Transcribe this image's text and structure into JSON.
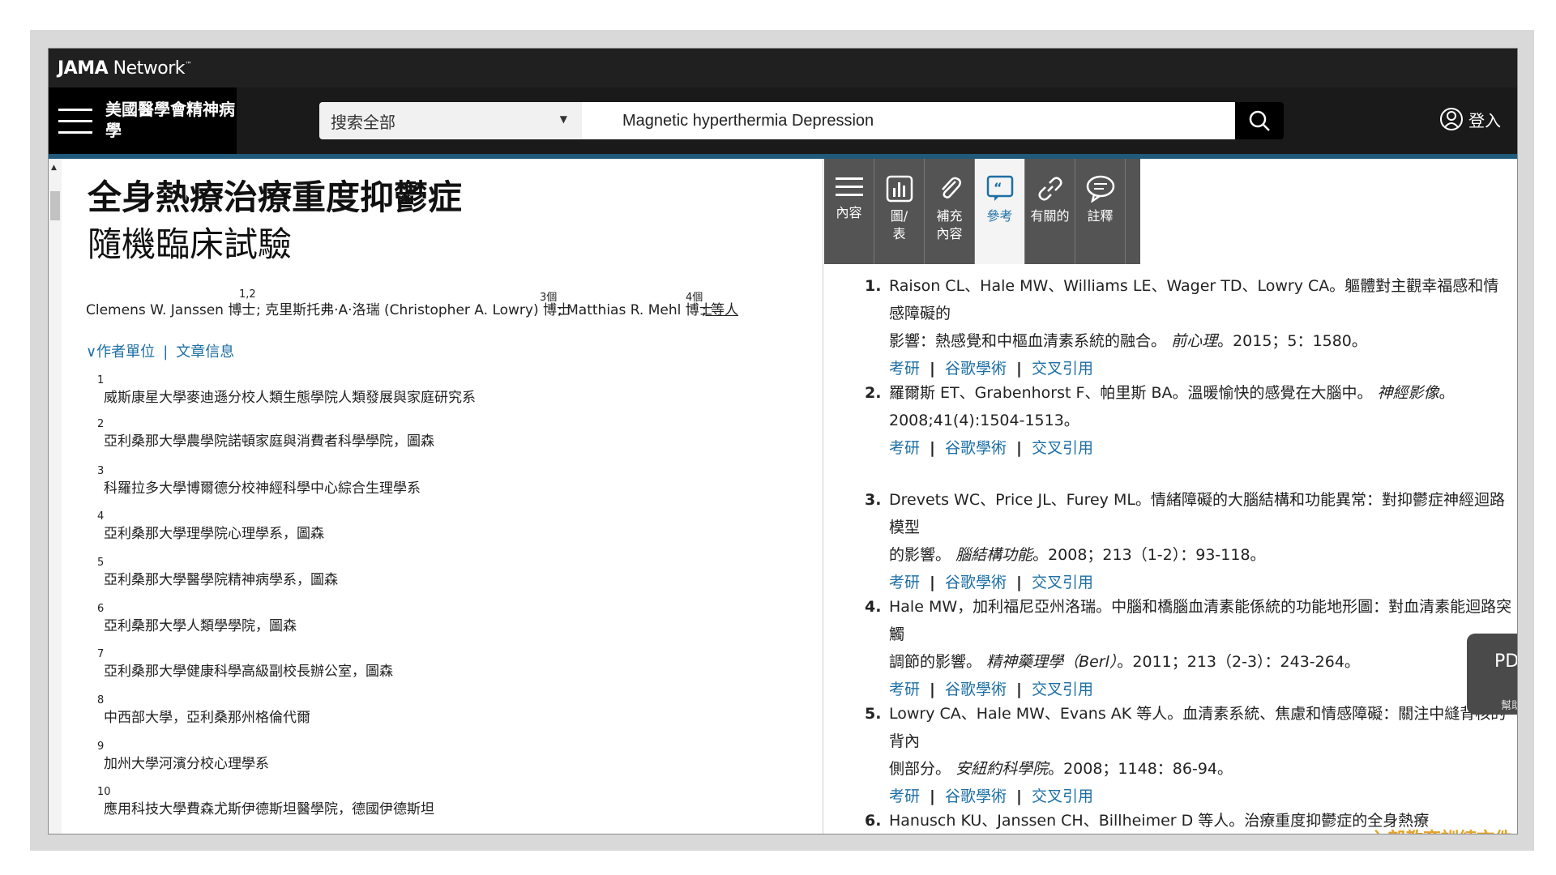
{
  "network": {
    "logo_bold": "JAMA",
    "logo_rest": " Network",
    "logo_mark": "™"
  },
  "header": {
    "brand": "美國醫學會精神病學",
    "search_scope": "搜索全部",
    "search_query": "Magnetic hyperthermia Depression",
    "signin": "登入"
  },
  "article": {
    "title": "全身熱療治療重度抑鬱症",
    "subtitle": "隨機臨床試驗",
    "authors": [
      {
        "name": "Clemens W. Janssen 博士",
        "sup": "1,2"
      },
      {
        "name": "; 克里斯托弗·A·洛瑞 (Christopher A. Lowry) 博士",
        "sup": "3個"
      },
      {
        "name": "; Matthias R. Mehl 博士",
        "sup": "4個"
      }
    ],
    "authors_more": "; 等人",
    "links": {
      "affiliations": "∨作者單位",
      "info": "文章信息"
    },
    "affiliations": [
      {
        "n": "1",
        "text": "威斯康星大學麥迪遜分校人類生態學院人類發展與家庭研究系"
      },
      {
        "n": "2",
        "text": "亞利桑那大學農學院諾頓家庭與消費者科學學院，圖森"
      },
      {
        "n": "3",
        "text": "科羅拉多大學博爾德分校神經科學中心綜合生理學系"
      },
      {
        "n": "4",
        "text": "亞利桑那大學理學院心理學系，圖森"
      },
      {
        "n": "5",
        "text": "亞利桑那大學醫學院精神病學系，圖森"
      },
      {
        "n": "6",
        "text": "亞利桑那大學人類學學院，圖森"
      },
      {
        "n": "7",
        "text": "亞利桑那大學健康科學高級副校長辦公室，圖森"
      },
      {
        "n": "8",
        "text": "中西部大學，亞利桑那州格倫代爾"
      },
      {
        "n": "9",
        "text": "加州大學河濱分校心理學系"
      },
      {
        "n": "10",
        "text": "應用科技大學費森尤斯伊德斯坦醫學院，德國伊德斯坦"
      }
    ]
  },
  "tools": [
    {
      "label": "內容",
      "icon": "menu-icon"
    },
    {
      "label": "圖/表",
      "icon": "chart-icon"
    },
    {
      "label": "補充內容",
      "icon": "paperclip-icon"
    },
    {
      "label": "參考",
      "icon": "quote-icon",
      "active": true
    },
    {
      "label": "有關的",
      "icon": "link-icon"
    },
    {
      "label": "註釋",
      "icon": "comment-icon"
    }
  ],
  "tool_lines": [
    [
      "內容"
    ],
    [
      "圖/",
      "表"
    ],
    [
      "補充",
      "內容"
    ],
    [
      "參考"
    ],
    [
      "有關的"
    ],
    [
      "註釋"
    ]
  ],
  "ref_links": {
    "a": "考研",
    "b": "谷歌學術",
    "c": "交叉引用",
    "sep": "|"
  },
  "references": [
    {
      "num": "1.",
      "line1": "Raison CL、Hale MW、Williams LE、Wager TD、Lowry CA。軀體對主觀幸福感和情感障礙的",
      "line2": "影響：熱感覺和中樞血清素系統的融合。",
      "journal": "前心理",
      "tail": "。2015；5：1580。"
    },
    {
      "num": "2.",
      "line1": "羅爾斯 ET、Grabenhorst F、帕里斯 BA。溫暖愉快的感覺在大腦中。",
      "journal1": "神經影像",
      "tail1": "。",
      "line2": "2008;41(4):1504-1513。"
    },
    {
      "num": "3.",
      "line1": "Drevets WC、Price JL、Furey ML。情緒障礙的大腦結構和功能異常：對抑鬱症神經迴路模型",
      "line2": "的影響。",
      "journal": "腦結構功能",
      "tail": "。2008；213（1-2）：93-118。"
    },
    {
      "num": "4.",
      "line1": "Hale MW，加利福尼亞州洛瑞。中腦和橋腦血清素能係統的功能地形圖：對血清素能迴路突觸",
      "line2": "調節的影響。",
      "journal": "精神藥理學（Berl）",
      "tail": "。2011；213（2-3）：243-264。"
    },
    {
      "num": "5.",
      "line1": "Lowry CA、Hale MW、Evans AK 等人。血清素系統、焦慮和情感障礙：關注中縫背核的背內",
      "line2": "側部分。",
      "journal": "安紐約科學院",
      "tail": "。2008；1148：86-94。"
    },
    {
      "num": "6.",
      "line1": "Hanusch KU、Janssen CH、Billheimer D 等人。治療重度抑鬱症的全身熱療"
    }
  ],
  "pdf": {
    "label": "PDF",
    "help": "幫助"
  },
  "watermark": "內部教育訓練文件"
}
